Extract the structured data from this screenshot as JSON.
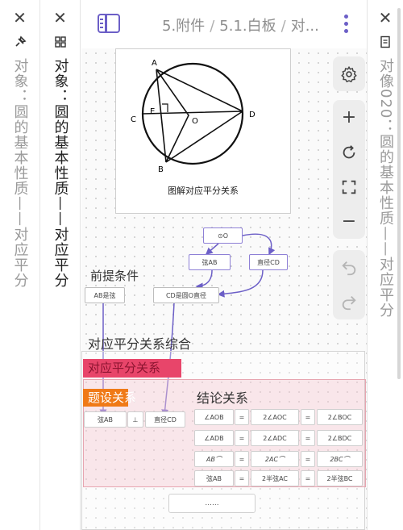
{
  "panes": [
    {
      "id": "left",
      "title": "对象：圆的基本性质——对应平分",
      "icon": "pin-icon"
    },
    {
      "id": "mid",
      "title": "对象：圆的基本性质——对应平分",
      "icon": "grid-icon"
    },
    {
      "id": "right",
      "title": "对像020：圆的基本性质——对应平分",
      "icon": "page-icon"
    }
  ],
  "header": {
    "breadcrumb": [
      "5.附件",
      "5.1.白板",
      "对..."
    ],
    "accent_color": "#6c5fc7"
  },
  "image_card": {
    "caption": "图解对应平分关系",
    "point_labels": {
      "A": "A",
      "B": "B",
      "C": "C",
      "D": "D",
      "E": "E",
      "O": "O"
    }
  },
  "canvas": {
    "premise_title": "前提条件",
    "summary_title": "对应平分关系综合",
    "nodes": {
      "circle_o": "⊙O",
      "chord_ab": "弦AB",
      "diameter_cd": "直径CD",
      "ab_is_chord": "AB是弦",
      "cd_is_diameter": "CD是圆O直径"
    },
    "label_red": "对应平分关系",
    "label_orange": "题设关系",
    "conclusion_title": "结论关系",
    "premise_row": [
      "弦AB",
      "⊥",
      "直径CD"
    ],
    "conclusion_rows": [
      [
        "∠AOB",
        "=",
        "2∠AOC",
        "=",
        "2∠BOC"
      ],
      [
        "∠ADB",
        "=",
        "2∠ADC",
        "=",
        "2∠BDC"
      ],
      [
        "AB⌒",
        "=",
        "2AC⌒",
        "=",
        "2BC⌒"
      ],
      [
        "弦AB",
        "=",
        "2半弦AC",
        "=",
        "2半弦BC"
      ]
    ],
    "bottom_node": "......"
  },
  "toolbar": {
    "settings": "gear-icon",
    "zoom_in": "+",
    "zoom_out": "−"
  }
}
